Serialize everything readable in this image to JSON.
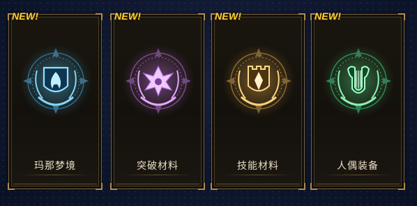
{
  "cards": [
    {
      "badge": "NEW!",
      "label": "玛那梦境",
      "icon": "flame-shield-icon",
      "color": "#4fc8ff"
    },
    {
      "badge": "NEW!",
      "label": "突破材料",
      "icon": "lotus-shield-icon",
      "color": "#d07cf2"
    },
    {
      "badge": "NEW!",
      "label": "技能材料",
      "icon": "tower-shield-icon",
      "color": "#f2b24a"
    },
    {
      "badge": "NEW!",
      "label": "人偶装备",
      "icon": "lyre-shield-icon",
      "color": "#4fdc84"
    }
  ]
}
